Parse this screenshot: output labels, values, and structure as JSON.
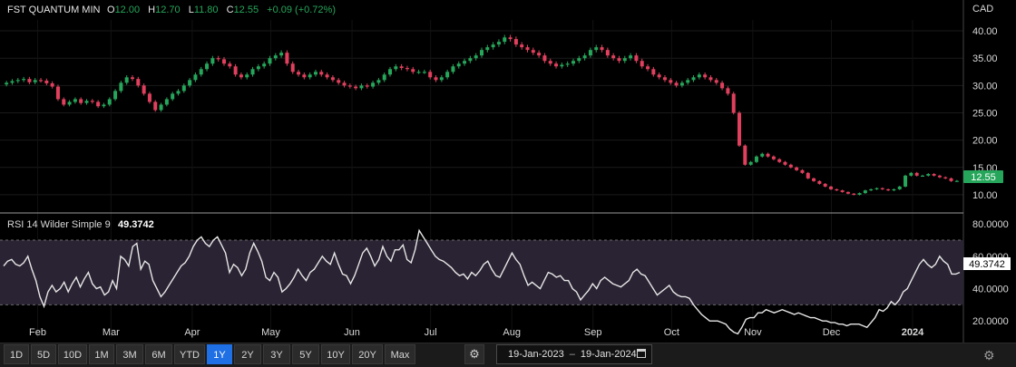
{
  "header": {
    "instrument": "FST QUANTUM MIN",
    "o_label": "O",
    "o_value": "12.00",
    "h_label": "H",
    "h_value": "12.70",
    "l_label": "L",
    "l_value": "11.80",
    "c_label": "C",
    "c_value": "12.55",
    "change": "+0.09 (+0.72%)",
    "currency": "CAD",
    "last_price": "12.55"
  },
  "rsi": {
    "label": "RSI 14 Wilder Simple 9",
    "value": "49.3742"
  },
  "colors": {
    "up": "#26a65b",
    "down": "#e0405e",
    "rsi_line": "#e6e6e6",
    "rsi_band": "#2a2333",
    "price_badge": "#26a65b"
  },
  "toolbar": {
    "ranges": [
      "1D",
      "5D",
      "10D",
      "1M",
      "3M",
      "6M",
      "YTD",
      "1Y",
      "2Y",
      "3Y",
      "5Y",
      "10Y",
      "20Y",
      "Max"
    ],
    "active": "1Y",
    "date_from": "19-Jan-2023",
    "date_sep": "–",
    "date_to": "19-Jan-2024"
  },
  "chart_data": [
    {
      "type": "candlestick",
      "title": "FST QUANTUM MIN",
      "x_range": [
        "2023-01-19",
        "2024-01-19"
      ],
      "x_tick_labels": [
        "Feb",
        "Mar",
        "Apr",
        "May",
        "Jun",
        "Jul",
        "Aug",
        "Sep",
        "Oct",
        "Nov",
        "Dec",
        "2024"
      ],
      "y_ticks": [
        10,
        15,
        20,
        25,
        30,
        35,
        40
      ],
      "y_tick_labels": [
        "10.00",
        "15.00",
        "20.00",
        "25.00",
        "30.00",
        "35.00",
        "40.00"
      ],
      "ylim": [
        7.5,
        42
      ],
      "close": [
        30.5,
        30.8,
        31.0,
        31.2,
        30.6,
        31.0,
        30.9,
        30.4,
        29.8,
        27.5,
        26.5,
        27.0,
        27.5,
        26.8,
        27.2,
        27.0,
        26.2,
        26.5,
        27.5,
        29.0,
        30.5,
        31.5,
        31.2,
        30.0,
        28.5,
        27.0,
        25.5,
        26.5,
        27.5,
        28.5,
        29.0,
        30.0,
        31.0,
        32.0,
        33.0,
        34.0,
        35.0,
        34.8,
        34.0,
        33.5,
        32.0,
        31.5,
        32.0,
        33.0,
        33.5,
        34.0,
        35.0,
        35.5,
        36.0,
        34.0,
        32.5,
        32.0,
        31.5,
        32.0,
        32.5,
        32.0,
        31.5,
        31.0,
        30.5,
        30.0,
        29.8,
        29.5,
        30.0,
        29.8,
        30.5,
        31.0,
        32.0,
        33.0,
        33.5,
        33.2,
        33.0,
        32.5,
        32.5,
        32.5,
        31.5,
        31.0,
        31.5,
        32.5,
        33.5,
        34.0,
        34.5,
        35.0,
        35.5,
        36.5,
        37.0,
        37.5,
        38.0,
        38.8,
        38.5,
        37.5,
        37.0,
        36.5,
        36.0,
        35.5,
        34.5,
        34.0,
        33.5,
        33.8,
        34.0,
        34.5,
        35.0,
        35.5,
        36.5,
        37.0,
        36.5,
        35.5,
        35.0,
        34.5,
        35.0,
        35.5,
        34.5,
        33.5,
        33.0,
        32.0,
        31.5,
        31.0,
        30.5,
        30.0,
        30.5,
        31.0,
        31.5,
        32.0,
        31.5,
        31.0,
        30.5,
        29.5,
        28.5,
        25.0,
        19.0,
        15.5,
        16.0,
        17.0,
        17.5,
        17.0,
        16.5,
        16.0,
        15.5,
        15.0,
        14.5,
        14.0,
        13.0,
        12.5,
        12.0,
        11.5,
        11.0,
        10.8,
        10.5,
        10.2,
        10.0,
        10.3,
        10.8,
        11.0,
        11.2,
        11.0,
        10.8,
        11.0,
        11.5,
        13.5,
        14.0,
        13.5,
        13.5,
        13.8,
        13.5,
        13.2,
        13.0,
        12.5,
        12.55
      ],
      "y_last": 12.55
    },
    {
      "type": "line",
      "title": "RSI 14 Wilder Simple 9",
      "y_ticks": [
        20,
        40,
        60,
        80
      ],
      "y_tick_labels": [
        "20.0000",
        "40.0000",
        "60.0000",
        "80.0000"
      ],
      "ylim": [
        10,
        84
      ],
      "band": [
        30,
        70
      ],
      "values": [
        54,
        57,
        58,
        55,
        54,
        56,
        60,
        52,
        45,
        35,
        29,
        38,
        42,
        38,
        40,
        44,
        38,
        43,
        47,
        41,
        46,
        50,
        43,
        40,
        41,
        36,
        38,
        45,
        40,
        60,
        58,
        54,
        66,
        68,
        52,
        57,
        55,
        45,
        40,
        35,
        38,
        42,
        46,
        50,
        54,
        56,
        60,
        66,
        70,
        72,
        68,
        66,
        70,
        72,
        67,
        62,
        50,
        55,
        53,
        48,
        52,
        62,
        68,
        63,
        57,
        47,
        45,
        50,
        47,
        38,
        40,
        43,
        47,
        52,
        48,
        45,
        50,
        52,
        56,
        60,
        57,
        55,
        62,
        55,
        49,
        48,
        43,
        48,
        55,
        62,
        65,
        60,
        54,
        58,
        66,
        60,
        57,
        64,
        64,
        67,
        58,
        56,
        64,
        76,
        72,
        68,
        64,
        60,
        58,
        57,
        55,
        53,
        50,
        48,
        49,
        46,
        50,
        48,
        51,
        55,
        57,
        52,
        48,
        47,
        52,
        57,
        62,
        58,
        55,
        48,
        42,
        44,
        42,
        40,
        45,
        50,
        49,
        47,
        48,
        45,
        45,
        40,
        38,
        33,
        36,
        39,
        43,
        40,
        45,
        47,
        45,
        43,
        42,
        41,
        43,
        45,
        50,
        52,
        49,
        48,
        44,
        40,
        36,
        38,
        40,
        42,
        38,
        36,
        35,
        35,
        34,
        30,
        27,
        24,
        22,
        20,
        20,
        20,
        19,
        18,
        15,
        13,
        12,
        16,
        21,
        22,
        22,
        25,
        25,
        27,
        26,
        25,
        26,
        27,
        26,
        25,
        24,
        25,
        24,
        23,
        22,
        22,
        21,
        20,
        20,
        19,
        19,
        18,
        18,
        17,
        18,
        18,
        18,
        17,
        16,
        19,
        22,
        27,
        26,
        28,
        32,
        30,
        33,
        38,
        40,
        45,
        50,
        55,
        58,
        55,
        53,
        55,
        60,
        57,
        55,
        49,
        49,
        50
      ],
      "y_last": 49.3742
    }
  ]
}
